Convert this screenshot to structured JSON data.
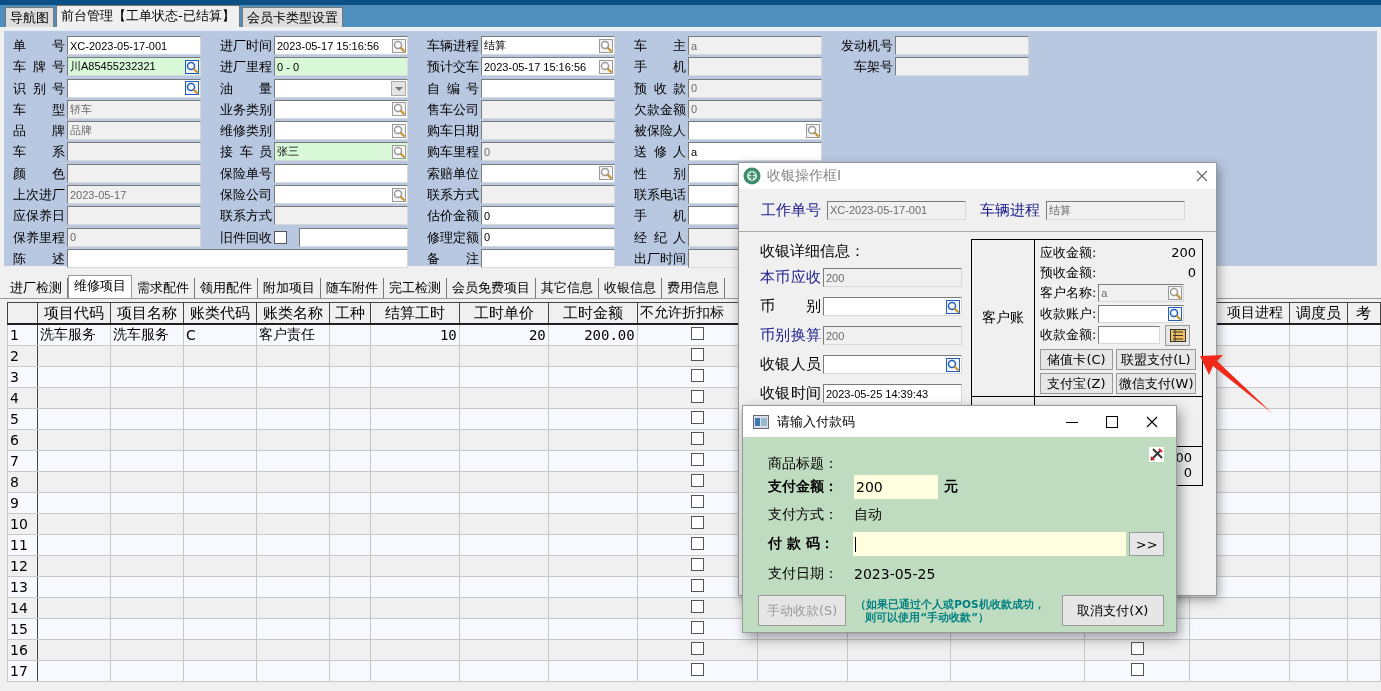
{
  "tabs": [
    {
      "label": "导航图",
      "selected": false
    },
    {
      "label": "前台管理【工单状态-已结算】",
      "selected": true
    },
    {
      "label": "会员卡类型设置",
      "selected": false
    }
  ],
  "form": {
    "columns": [
      [
        {
          "label": "单号",
          "value": "XC-2023-05-17-001",
          "kind": "editable"
        },
        {
          "label": "车牌号",
          "value": "川A85455232321",
          "kind": "required",
          "picker": true
        },
        {
          "label": "识别号",
          "kind": "editable",
          "picker": true
        },
        {
          "label": "车型",
          "value": "轿车",
          "kind": "readonly"
        },
        {
          "label": "品牌",
          "value": "品牌",
          "kind": "readonly"
        },
        {
          "label": "车系",
          "kind": "readonly"
        },
        {
          "label": "颜色",
          "kind": "readonly"
        },
        {
          "label": "上次进厂",
          "value": "2023-05-17",
          "kind": "readonly"
        },
        {
          "label": "应保养日",
          "kind": "readonly"
        },
        {
          "label": "保养里程",
          "value": "0",
          "kind": "readonly"
        }
      ],
      [
        {
          "label": "进厂时间",
          "value": "2023-05-17 15:16:56",
          "kind": "editable",
          "lookup": true
        },
        {
          "label": "进厂里程",
          "value": "0 - 0",
          "kind": "required"
        },
        {
          "label": "油量",
          "kind": "editable",
          "dropdown": true
        },
        {
          "label": "业务类别",
          "kind": "editable",
          "lookup": true
        },
        {
          "label": "维修类别",
          "kind": "editable",
          "lookup": true
        },
        {
          "label": "接车员",
          "value": "张三",
          "kind": "required",
          "lookup": true
        },
        {
          "label": "保险单号",
          "kind": "editable"
        },
        {
          "label": "保险公司",
          "kind": "editable",
          "lookup": true
        },
        {
          "label": "联系方式",
          "kind": "readonly"
        },
        {
          "label": "旧件回收",
          "kind": "checkbox_field",
          "checked": false
        }
      ],
      [
        {
          "label": "车辆进程",
          "value": "结算",
          "kind": "editable",
          "lookup": true
        },
        {
          "label": "预计交车",
          "value": "2023-05-17 15:16:56",
          "kind": "editable",
          "lookup": true
        },
        {
          "label": "自编号",
          "kind": "editable"
        },
        {
          "label": "售车公司",
          "kind": "readonly"
        },
        {
          "label": "购车日期",
          "kind": "readonly"
        },
        {
          "label": "购车里程",
          "value": "0",
          "kind": "readonly"
        },
        {
          "label": "索赔单位",
          "kind": "editable",
          "lookup": true
        },
        {
          "label": "联系方式",
          "kind": "readonly"
        },
        {
          "label": "估价金额",
          "value": "0",
          "kind": "editable"
        },
        {
          "label": "修理定额",
          "value": "0",
          "kind": "editable"
        },
        {
          "label": "备注",
          "kind": "editable"
        }
      ],
      [
        {
          "label": "车主",
          "value": "a",
          "kind": "readonly"
        },
        {
          "label": "手机",
          "kind": "readonly"
        },
        {
          "label": "预收款",
          "value": "0",
          "kind": "readonly"
        },
        {
          "label": "欠款金额",
          "value": "0",
          "kind": "readonly"
        },
        {
          "label": "被保险人",
          "kind": "editable",
          "lookup": true
        },
        {
          "label": "送修人",
          "value": "a",
          "kind": "editable"
        },
        {
          "label": "性别",
          "kind": "editable"
        },
        {
          "label": "联系电话",
          "kind": "editable"
        },
        {
          "label": "手机",
          "kind": "editable"
        },
        {
          "label": "经纪人",
          "kind": "readonly"
        },
        {
          "label": "出厂时间",
          "kind": "readonly"
        }
      ],
      [
        {
          "label": "发动机号",
          "kind": "readonly"
        },
        {
          "label": "车架号",
          "kind": "readonly"
        }
      ]
    ],
    "statement": {
      "label": "陈述",
      "kind": "editable"
    }
  },
  "subtabs": [
    {
      "label": "进厂检测",
      "selected": false
    },
    {
      "label": "维修项目",
      "selected": true
    },
    {
      "label": "需求配件",
      "selected": false
    },
    {
      "label": "领用配件",
      "selected": false
    },
    {
      "label": "附加项目",
      "selected": false
    },
    {
      "label": "随车附件",
      "selected": false
    },
    {
      "label": "完工检测",
      "selected": false
    },
    {
      "label": "会员免费项目",
      "selected": false
    },
    {
      "label": "其它信息",
      "selected": false
    },
    {
      "label": "收银信息",
      "selected": false
    },
    {
      "label": "费用信息",
      "selected": false
    }
  ],
  "table": {
    "columns": [
      {
        "label": "项目代码",
        "kind": "text"
      },
      {
        "label": "项目名称",
        "kind": "text"
      },
      {
        "label": "账类代码",
        "kind": "text"
      },
      {
        "label": "账类名称",
        "kind": "text"
      },
      {
        "label": "工种",
        "kind": "text"
      },
      {
        "label": "结算工时",
        "kind": "number"
      },
      {
        "label": "工时单价",
        "kind": "number"
      },
      {
        "label": "工时金额",
        "kind": "number"
      },
      {
        "label": "不允许折扣标",
        "kind": "check"
      },
      {
        "kind": "text"
      },
      {
        "kind": "text"
      },
      {
        "kind": "text"
      },
      {
        "kind": "check"
      },
      {
        "label": "项目进程",
        "kind": "text"
      },
      {
        "label": "调度员",
        "kind": "text"
      },
      {
        "label": "考",
        "kind": "text"
      }
    ],
    "rows": [
      {
        "number": "1",
        "cells": [
          {
            "text": "洗车服务"
          },
          {
            "text": "洗车服务"
          },
          {
            "text": "C"
          },
          {
            "text": "客户责任"
          },
          {},
          {
            "text": "10"
          },
          {
            "text": "20"
          },
          {
            "text": "200.00"
          },
          {
            "checked": false
          }
        ]
      },
      {
        "number": "2",
        "cells": [
          {},
          {},
          {},
          {},
          {},
          {},
          {},
          {},
          {
            "checked": false
          }
        ]
      },
      {
        "number": "3",
        "cells": [
          {},
          {},
          {},
          {},
          {},
          {},
          {},
          {},
          {
            "checked": false
          }
        ]
      },
      {
        "number": "4",
        "cells": [
          {},
          {},
          {},
          {},
          {},
          {},
          {},
          {},
          {
            "checked": false
          }
        ]
      },
      {
        "number": "5",
        "cells": [
          {},
          {},
          {},
          {},
          {},
          {},
          {},
          {},
          {
            "checked": false
          }
        ]
      },
      {
        "number": "6",
        "cells": [
          {},
          {},
          {},
          {},
          {},
          {},
          {},
          {},
          {
            "checked": false
          }
        ]
      },
      {
        "number": "7",
        "cells": [
          {},
          {},
          {},
          {},
          {},
          {},
          {},
          {},
          {
            "checked": false
          }
        ]
      },
      {
        "number": "8",
        "cells": [
          {},
          {},
          {},
          {},
          {},
          {},
          {},
          {},
          {
            "checked": false
          }
        ]
      },
      {
        "number": "9",
        "cells": [
          {},
          {},
          {},
          {},
          {},
          {},
          {},
          {},
          {
            "checked": false
          }
        ]
      },
      {
        "number": "10",
        "cells": [
          {},
          {},
          {},
          {},
          {},
          {},
          {},
          {},
          {
            "checked": false
          }
        ]
      },
      {
        "number": "11",
        "cells": [
          {},
          {},
          {},
          {},
          {},
          {},
          {},
          {},
          {
            "checked": false
          }
        ]
      },
      {
        "number": "12",
        "cells": [
          {},
          {},
          {},
          {},
          {},
          {},
          {},
          {},
          {
            "checked": false
          }
        ]
      },
      {
        "number": "13",
        "cells": [
          {},
          {},
          {},
          {},
          {},
          {},
          {},
          {},
          {
            "checked": false
          }
        ]
      },
      {
        "number": "14",
        "cells": [
          {},
          {},
          {},
          {},
          {},
          {},
          {},
          {},
          {
            "checked": false
          }
        ]
      },
      {
        "number": "15",
        "cells": [
          {},
          {},
          {},
          {},
          {},
          {},
          {},
          {},
          {
            "checked": false
          }
        ]
      },
      {
        "number": "16",
        "cells": [
          {},
          {},
          {},
          {},
          {},
          {},
          {},
          {},
          {
            "checked": false
          },
          {},
          {},
          {},
          {
            "checked": false
          }
        ]
      },
      {
        "number": "17",
        "cells": [
          {},
          {},
          {},
          {},
          {},
          {},
          {},
          {},
          {
            "checked": false
          },
          {},
          {},
          {},
          {
            "checked": false
          }
        ]
      }
    ]
  },
  "cashier_dialog": {
    "title": "收银操作框I",
    "order_label": "工作单号",
    "order_no": "XC-2023-05-17-001",
    "progress_label": "车辆进程",
    "progress": "结算",
    "detail_heading": "收银详细信息：",
    "fields": [
      {
        "label": "本币应收",
        "value": "200",
        "kind": "readonly"
      },
      {
        "label": "币别",
        "kind": "editable",
        "picker": true
      },
      {
        "label": "币别换算",
        "value": "200",
        "kind": "readonly"
      },
      {
        "label": "收银人员",
        "kind": "editable",
        "picker": true
      },
      {
        "label": "收银时间",
        "value": "2023-05-25 14:39:43",
        "kind": "editable"
      }
    ],
    "account": {
      "label": "客户账",
      "amounts": [
        {
          "label": "应收金额:",
          "value": "200"
        },
        {
          "label": "预收金额:",
          "value": "0"
        }
      ],
      "inputs": [
        {
          "label": "客户名称:",
          "value": "a",
          "kind": "readonly",
          "lookup": true
        },
        {
          "label": "收款账户:",
          "kind": "editable",
          "picker": true
        },
        {
          "label": "收款金额:",
          "kind": "editable",
          "ledger": true
        }
      ],
      "buttons": [
        "储值卡(C)",
        "联盟支付(L)",
        "支付宝(Z)",
        "微信支付(W)"
      ],
      "lower_values": [
        "00",
        "0"
      ]
    }
  },
  "payment_dialog": {
    "title": "请输入付款码",
    "subject_label": "商品标题：",
    "amount_label": "支付金额：",
    "amount": "200",
    "currency": "元",
    "method_label": "支付方式：",
    "method": "自动",
    "code_label": "付 款 码：",
    "submit": ">>",
    "date_label": "支付日期：",
    "date": "2023-05-25",
    "manual_button": {
      "label": "手动收款(S)",
      "disabled": true
    },
    "note_lines": [
      "（如果已通过个人或POS机收款成功，",
      "则可以使用“手动收款”）"
    ],
    "cancel_button": "取消支付(X)"
  }
}
